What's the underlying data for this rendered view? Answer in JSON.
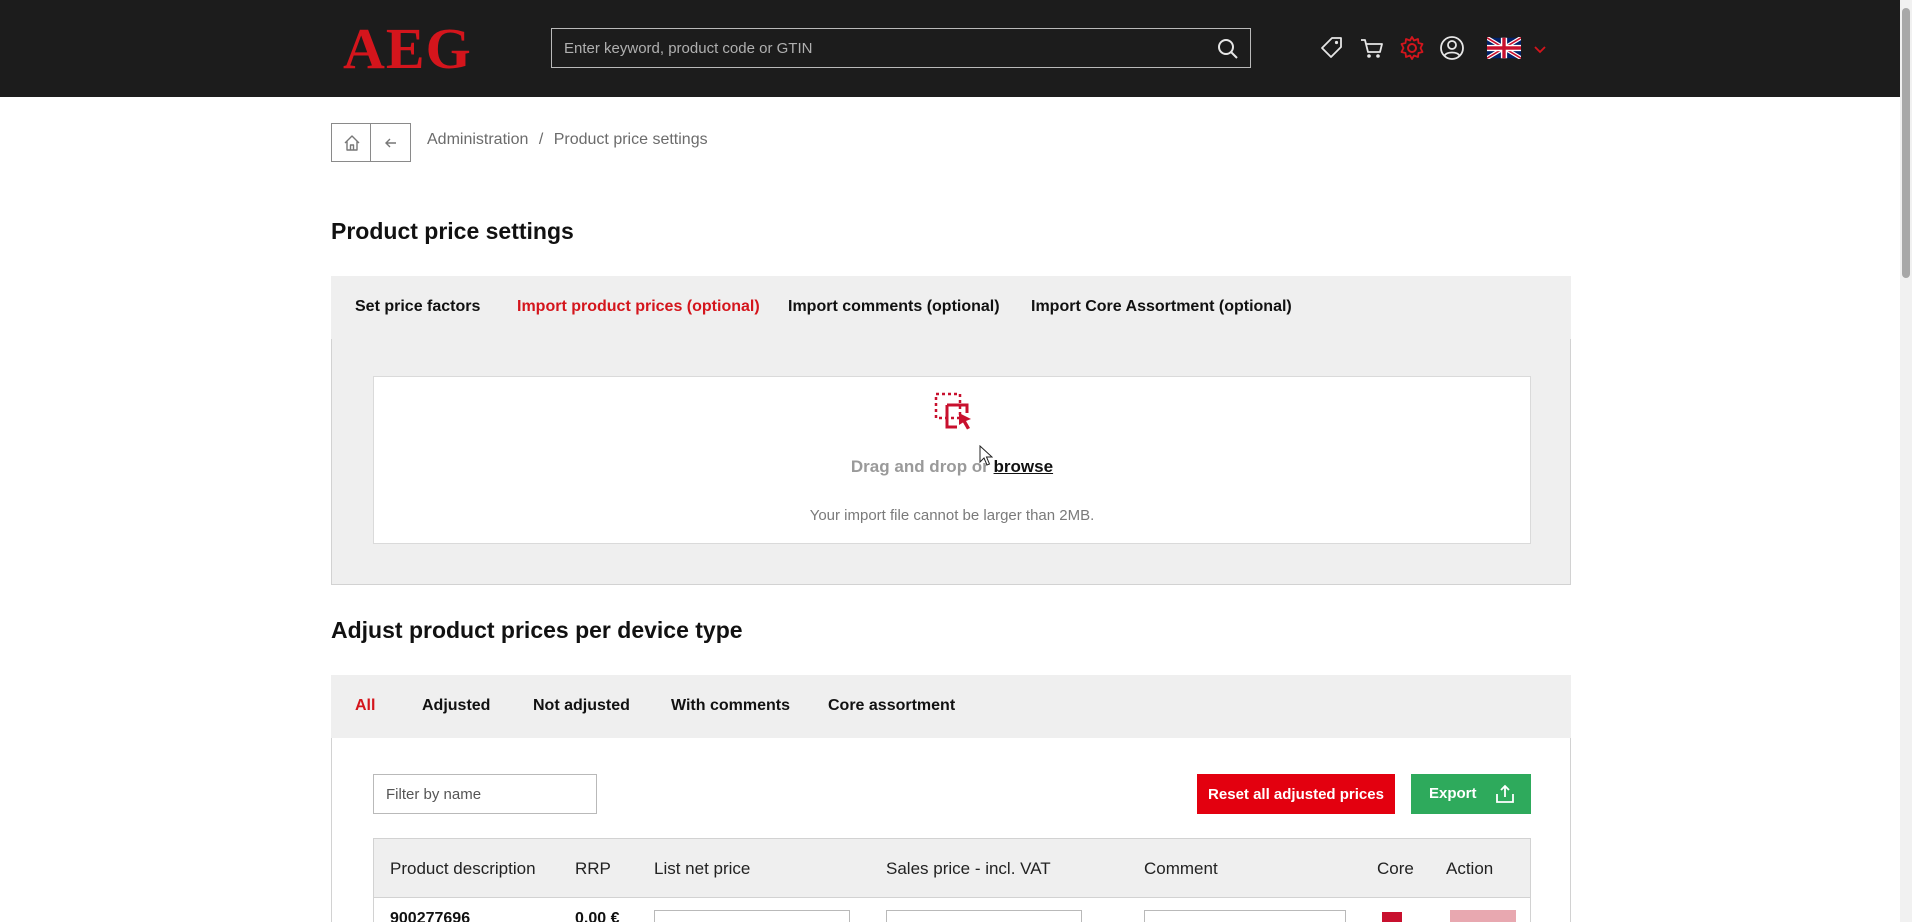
{
  "header": {
    "logo": "AEG",
    "search_placeholder": "Enter keyword, product code or GTIN",
    "icons": [
      "tag-icon",
      "cart-icon",
      "gear-icon",
      "user-icon",
      "uk-flag-icon",
      "chevron-down-icon"
    ],
    "accent_color": "#d4151c"
  },
  "breadcrumb": {
    "items": [
      "Administration",
      "/",
      "Product price settings"
    ]
  },
  "page_title": "Product price settings",
  "import_tabs": {
    "items": [
      {
        "label": "Set price factors",
        "active": false
      },
      {
        "label": "Import product prices (optional)",
        "active": true
      },
      {
        "label": "Import comments (optional)",
        "active": false
      },
      {
        "label": "Import Core Assortment (optional)",
        "active": false
      }
    ]
  },
  "upload": {
    "drag_text": "Drag and drop or",
    "browse_text": "browse",
    "note": "Your import file cannot be larger than 2MB."
  },
  "section_title": "Adjust product prices per device type",
  "filter_tabs": {
    "items": [
      {
        "label": "All",
        "active": true
      },
      {
        "label": "Adjusted",
        "active": false
      },
      {
        "label": "Not adjusted",
        "active": false
      },
      {
        "label": "With comments",
        "active": false
      },
      {
        "label": "Core assortment",
        "active": false
      }
    ]
  },
  "toolbar": {
    "filter_placeholder": "Filter by name",
    "reset_label": "Reset all adjusted prices",
    "export_label": "Export"
  },
  "table": {
    "columns": [
      "Product description",
      "RRP",
      "List net price",
      "Sales price - incl. VAT",
      "Comment",
      "Core",
      "Action"
    ],
    "rows": [
      {
        "product": "900277696",
        "rrp": "0,00 €",
        "core": true
      }
    ]
  },
  "colors": {
    "header_bg": "#1c1c1c",
    "reset_button": "#e3000f",
    "export_button": "#2eaa5c"
  }
}
